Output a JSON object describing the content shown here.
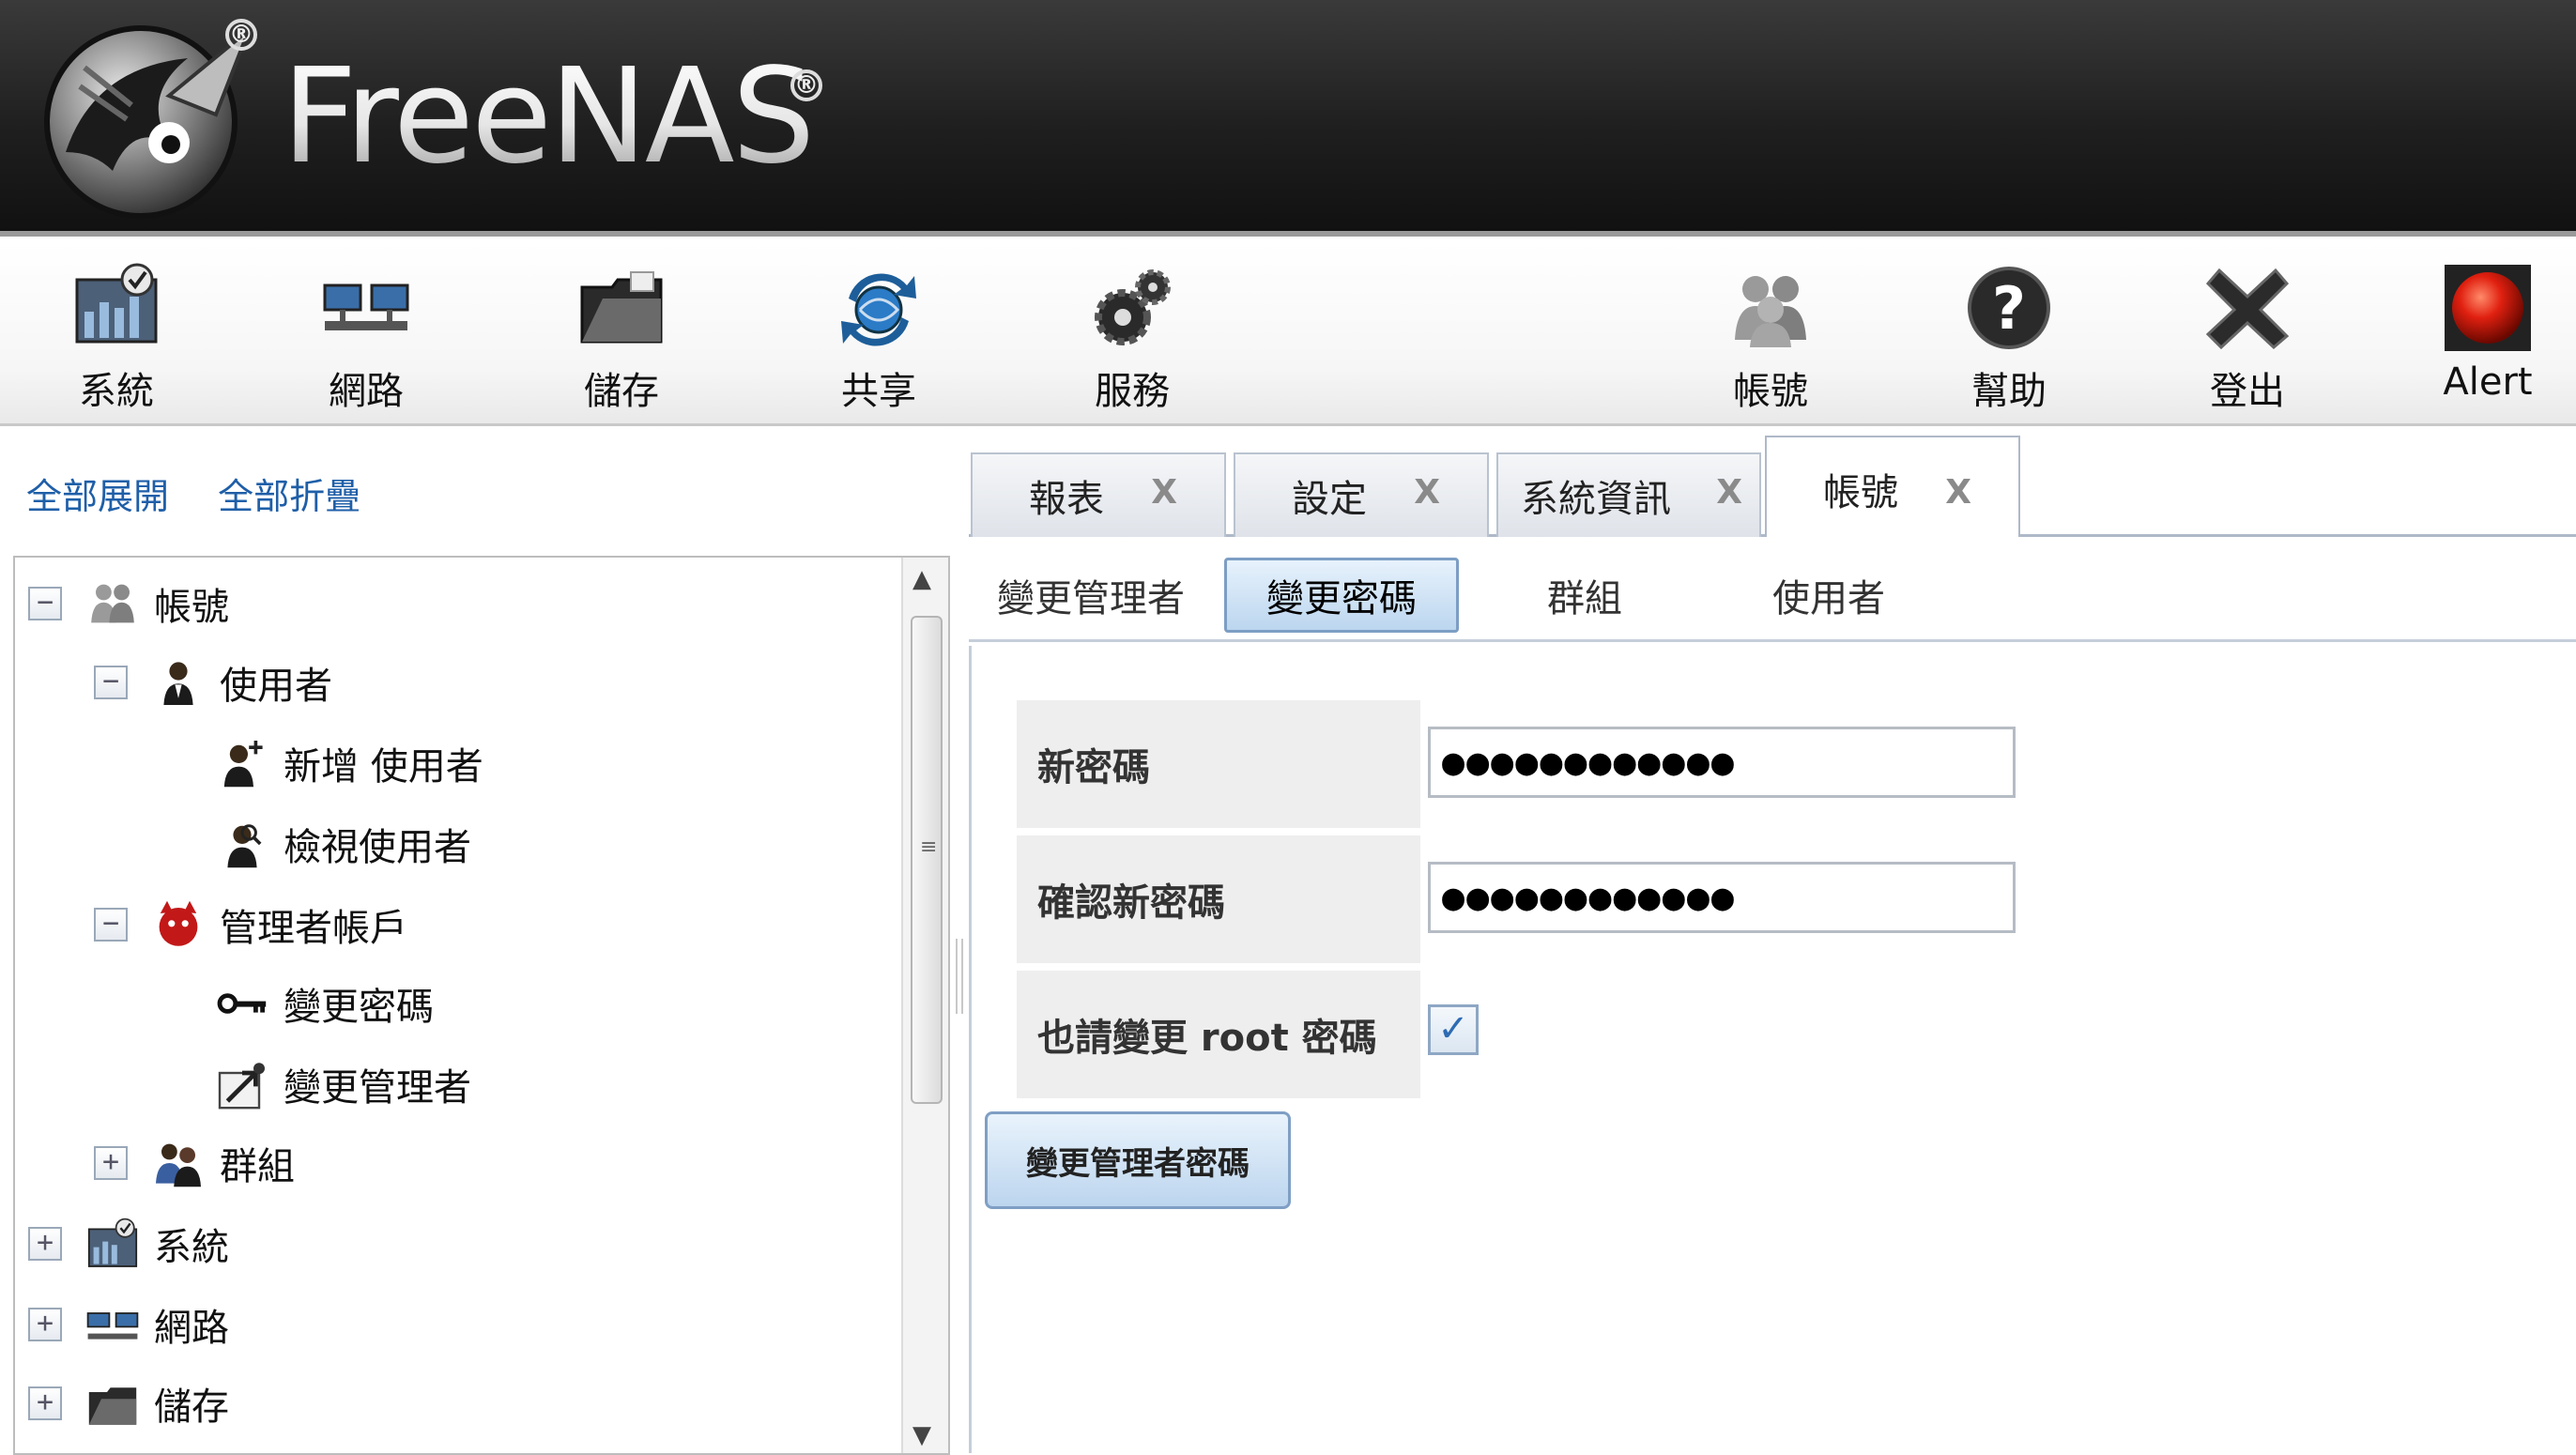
{
  "app": {
    "title": "FreeNAS",
    "reg_mark": "®"
  },
  "toolbar": {
    "items": [
      {
        "label": "系統",
        "icon": "system-icon"
      },
      {
        "label": "網路",
        "icon": "network-icon"
      },
      {
        "label": "儲存",
        "icon": "storage-icon"
      },
      {
        "label": "共享",
        "icon": "sharing-icon"
      },
      {
        "label": "服務",
        "icon": "services-icon"
      },
      {
        "label": "帳號",
        "icon": "account-icon"
      },
      {
        "label": "幫助",
        "icon": "help-icon"
      },
      {
        "label": "登出",
        "icon": "logout-icon"
      },
      {
        "label": "Alert",
        "icon": "alert-icon"
      }
    ]
  },
  "left": {
    "expand_all": "全部展開",
    "collapse_all": "全部折疊",
    "tree": [
      {
        "label": "帳號",
        "toggle": "−",
        "icon": "account-icon"
      },
      {
        "label": "使用者",
        "toggle": "−",
        "icon": "user-icon"
      },
      {
        "label": "新增 使用者",
        "toggle": "",
        "icon": "add-user-icon"
      },
      {
        "label": "檢視使用者",
        "toggle": "",
        "icon": "view-users-icon"
      },
      {
        "label": "管理者帳戶",
        "toggle": "−",
        "icon": "admin-icon"
      },
      {
        "label": "變更密碼",
        "toggle": "",
        "icon": "key-icon"
      },
      {
        "label": "變更管理者",
        "toggle": "",
        "icon": "change-admin-icon"
      },
      {
        "label": "群組",
        "toggle": "+",
        "icon": "group-icon"
      },
      {
        "label": "系統",
        "toggle": "+",
        "icon": "system-icon"
      },
      {
        "label": "網路",
        "toggle": "+",
        "icon": "network-icon"
      },
      {
        "label": "儲存",
        "toggle": "+",
        "icon": "storage-icon"
      }
    ],
    "scroll_up": "▲",
    "scroll_down": "▼",
    "scroll_grip": "≡"
  },
  "tabs": [
    {
      "label": "報表",
      "close": "X"
    },
    {
      "label": "設定",
      "close": "X"
    },
    {
      "label": "系統資訊",
      "close": "X"
    },
    {
      "label": "帳號",
      "close": "X",
      "active": true
    }
  ],
  "subtabs": [
    {
      "label": "變更管理者"
    },
    {
      "label": "變更密碼",
      "active": true
    },
    {
      "label": "群組"
    },
    {
      "label": "使用者"
    }
  ],
  "form": {
    "new_password_label": "新密碼",
    "new_password_value": "●●●●●●●●●●●●",
    "confirm_password_label": "確認新密碼",
    "confirm_password_value": "●●●●●●●●●●●●",
    "root_label": "也請變更 root 密碼",
    "root_checked": "✓",
    "submit_label": "變更管理者密碼"
  },
  "colors": {
    "link": "#1f5fa8",
    "active_tab_bg": "#ffffff",
    "accent_blue": "#bcd6ef",
    "alert_red": "#e02010"
  }
}
